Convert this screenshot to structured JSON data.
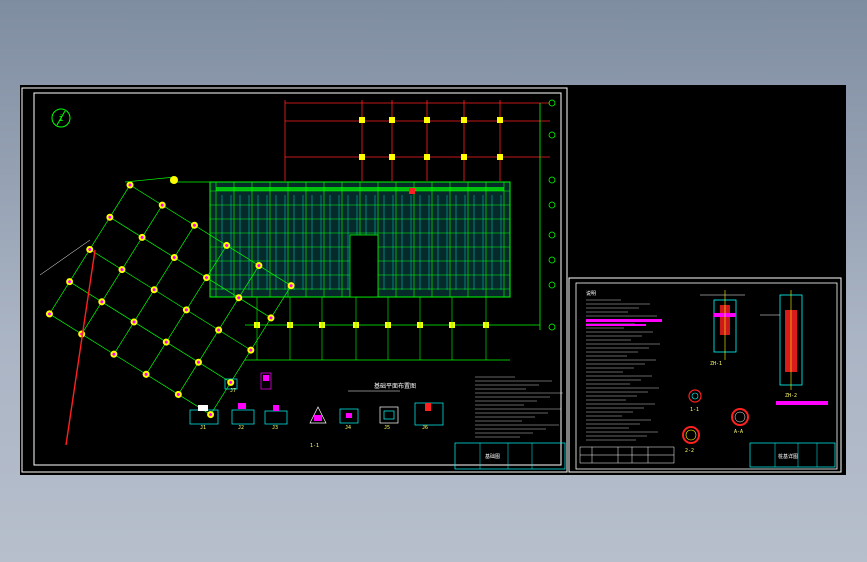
{
  "drawing_view": {
    "sheet_1": {
      "marker_symbol": "i",
      "plan_title": "基础平面布置图",
      "detail_labels": [
        "J1",
        "J2",
        "J3",
        "J4",
        "J5",
        "J6",
        "J7",
        "1-1",
        "2-2",
        "3-3",
        "4-4"
      ],
      "title_block_text": "基础图"
    },
    "sheet_2": {
      "notes_heading": "说明",
      "detail_labels": [
        "ZH-1",
        "ZH-2",
        "1-1",
        "2-2",
        "A-A"
      ],
      "title_block_text": "桩基详图"
    }
  },
  "colors": {
    "background": "#000000",
    "grid_lines": "#00ff00",
    "axis_lines": "#ff2020",
    "rebar": "#00ffff",
    "highlight": "#ff00ff",
    "frame": "#ffffff",
    "labels": "#ffff66"
  }
}
